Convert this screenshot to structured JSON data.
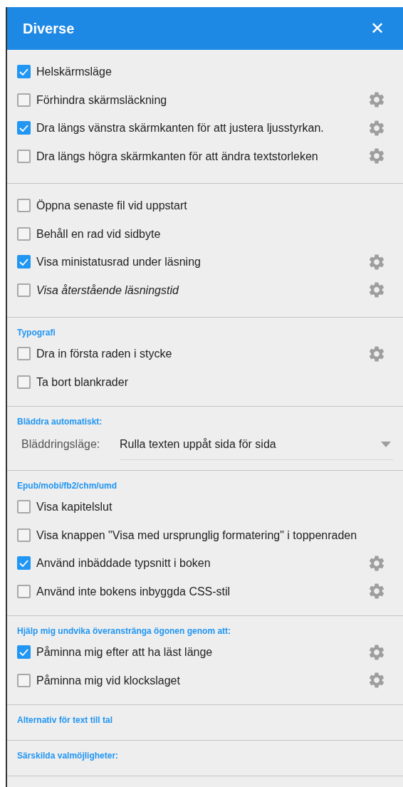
{
  "window": {
    "title": "Diverse",
    "close": "✕"
  },
  "sections": [
    {
      "items": [
        {
          "kind": "checkbox",
          "label": "Helskärmsläge",
          "checked": true,
          "settings": false,
          "italic": false
        },
        {
          "kind": "checkbox",
          "label": "Förhindra skärmsläckning",
          "checked": false,
          "settings": true,
          "italic": false
        },
        {
          "kind": "checkbox",
          "label": "Dra längs vänstra skärmkanten för att justera ljusstyrkan.",
          "checked": true,
          "settings": true,
          "italic": false
        },
        {
          "kind": "checkbox",
          "label": "Dra längs högra skärmkanten för att ändra textstorleken",
          "checked": false,
          "settings": true,
          "italic": false
        }
      ]
    },
    {
      "items": [
        {
          "kind": "checkbox",
          "label": "Öppna senaste fil vid uppstart",
          "checked": false,
          "settings": false,
          "italic": false
        },
        {
          "kind": "checkbox",
          "label": "Behåll en rad vid sidbyte",
          "checked": false,
          "settings": false,
          "italic": false
        },
        {
          "kind": "checkbox",
          "label": "Visa ministatusrad under läsning",
          "checked": true,
          "settings": true,
          "italic": false
        },
        {
          "kind": "checkbox",
          "label": "Visa återstående läsningstid",
          "checked": false,
          "settings": true,
          "italic": true
        }
      ]
    },
    {
      "title": "Typografi",
      "items": [
        {
          "kind": "checkbox",
          "label": "Dra in första raden i stycke",
          "checked": false,
          "settings": true,
          "italic": false
        },
        {
          "kind": "checkbox",
          "label": "Ta bort blankrader",
          "checked": false,
          "settings": false,
          "italic": false
        }
      ]
    },
    {
      "title": "Bläddra automatiskt:",
      "items": [
        {
          "kind": "dropdown",
          "label": "Bläddringsläge:",
          "value": "Rulla texten uppåt sida för sida"
        }
      ]
    },
    {
      "title": "Epub/mobi/fb2/chm/umd",
      "items": [
        {
          "kind": "checkbox",
          "label": "Visa kapitelslut",
          "checked": false,
          "settings": false,
          "italic": false
        },
        {
          "kind": "checkbox",
          "label": "Visa knappen \"Visa med ursprunglig formatering\" i toppenraden",
          "checked": false,
          "settings": false,
          "italic": false
        },
        {
          "kind": "checkbox",
          "label": "Använd inbäddade typsnitt i boken",
          "checked": true,
          "settings": true,
          "italic": false
        },
        {
          "kind": "checkbox",
          "label": "Använd inte bokens inbyggda CSS-stil",
          "checked": false,
          "settings": true,
          "italic": false
        }
      ]
    },
    {
      "title": "Hjälp mig undvika överanstränga ögonen genom att:",
      "items": [
        {
          "kind": "checkbox",
          "label": "Påminna mig efter att ha läst länge",
          "checked": true,
          "settings": true,
          "italic": false
        },
        {
          "kind": "checkbox",
          "label": "Påminna mig vid klockslaget",
          "checked": false,
          "settings": true,
          "italic": false
        }
      ]
    },
    {
      "title": "Alternativ för text till tal"
    },
    {
      "title": "Särskilda valmöjligheter:"
    }
  ]
}
